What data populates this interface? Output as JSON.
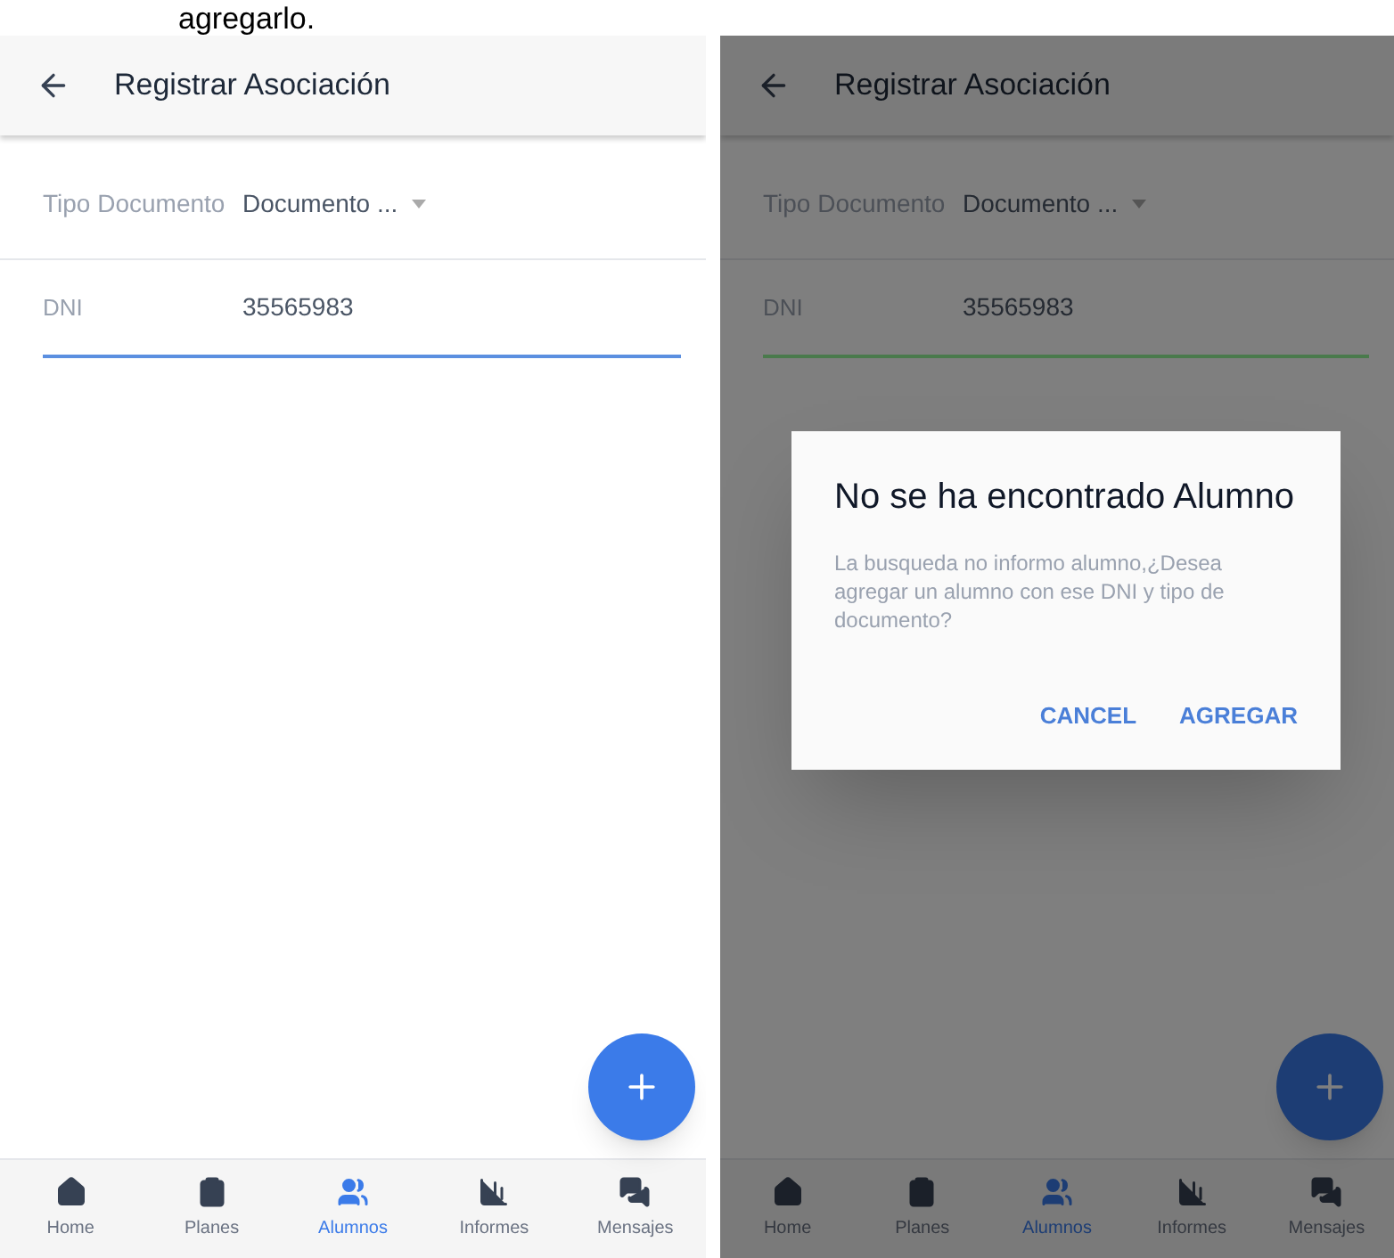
{
  "caption": "agregarlo.",
  "screens": [
    {
      "title": "Registrar Asociación",
      "dimmed": false,
      "fields": [
        {
          "label": "Tipo Documento",
          "value": "Documento ...",
          "kind": "dropdown"
        },
        {
          "label": "DNI",
          "value": "35565983",
          "kind": "text",
          "color": "#5b8fe0"
        }
      ],
      "nav": [
        {
          "label": "Home",
          "selected": false
        },
        {
          "label": "Planes",
          "selected": false
        },
        {
          "label": "Alumnos",
          "selected": true
        },
        {
          "label": "Informes",
          "selected": false
        },
        {
          "label": "Mensajes",
          "selected": false
        }
      ]
    },
    {
      "title": "Registrar Asociación",
      "dimmed": true,
      "fields": [
        {
          "label": "Tipo Documento",
          "value": "Documento ...",
          "kind": "dropdown"
        },
        {
          "label": "DNI",
          "value": "35565983",
          "kind": "text",
          "color": "#4a7a4c"
        }
      ],
      "nav": [
        {
          "label": "Home",
          "selected": false
        },
        {
          "label": "Planes",
          "selected": false
        },
        {
          "label": "Alumnos",
          "selected": true
        },
        {
          "label": "Informes",
          "selected": false
        },
        {
          "label": "Mensajes",
          "selected": false
        }
      ],
      "dialog": {
        "title": "No se ha encontrado Alumno",
        "message": "La busqueda no informo alumno,¿Desea agregar un alumno con ese DNI y tipo de documento?",
        "buttons": [
          "CANCEL",
          "AGREGAR"
        ]
      }
    }
  ]
}
